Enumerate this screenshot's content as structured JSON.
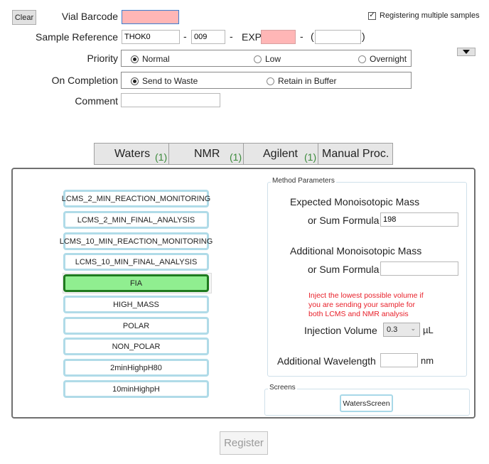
{
  "header": {
    "clear_label": "Clear",
    "vial_barcode_label": "Vial Barcode",
    "vial_barcode_value": "",
    "multi_samples_label": "Registering multiple samples",
    "multi_samples_checked": true,
    "sample_reference_label": "Sample Reference",
    "sample_ref_prefix": "THOK0",
    "sample_ref_sep1": "-",
    "sample_ref_number": "009",
    "sample_ref_sep2": "-",
    "exp_label": "EXP",
    "exp_value": "",
    "sample_ref_sep3": "-",
    "paren_open": "(",
    "paren_value": "",
    "paren_close": ")",
    "priority_label": "Priority",
    "priority_options": [
      "Normal",
      "Low",
      "Overnight"
    ],
    "priority_selected": "Normal",
    "on_completion_label": "On Completion",
    "completion_options": [
      "Send to Waste",
      "Retain in Buffer"
    ],
    "completion_selected": "Send to Waste",
    "comment_label": "Comment",
    "comment_value": "",
    "expand_icon": "triangle-down-icon"
  },
  "tabs": [
    {
      "label": "Waters",
      "count": "(1)"
    },
    {
      "label": "NMR",
      "count": "(1)"
    },
    {
      "label": "Agilent",
      "count": "(1)"
    },
    {
      "label": "Manual Proc.",
      "count": ""
    }
  ],
  "methods": {
    "items": [
      "LCMS_2_MIN_REACTION_MONITORING",
      "LCMS_2_MIN_FINAL_ANALYSIS",
      "LCMS_10_MIN_REACTION_MONITORING",
      "LCMS_10_MIN_FINAL_ANALYSIS",
      "FIA",
      "HIGH_MASS",
      "POLAR",
      "NON_POLAR",
      "2minHighpH80",
      "10minHighpH"
    ],
    "selected": "FIA"
  },
  "method_parameters": {
    "legend": "Method Parameters",
    "expected_mass_label": "Expected Monoisotopic Mass",
    "expected_formula_label": "or Sum Formula",
    "expected_formula_value": "198",
    "additional_mass_label": "Additional Monoisotopic Mass",
    "additional_formula_label": "or Sum Formula",
    "additional_formula_value": "",
    "warning_line1": "Inject the lowest possible volume if",
    "warning_line2": "you are sending your sample for",
    "warning_line3": "both LCMS and NMR analysis",
    "warning_color": "#e8202a",
    "injection_volume_label": "Injection Volume",
    "injection_volume_value": "0.3",
    "injection_volume_unit": "µL",
    "wavelength_label": "Additional Wavelength",
    "wavelength_value": "",
    "wavelength_unit": "nm"
  },
  "screens": {
    "legend": "Screens",
    "button_label": "WatersScreen"
  },
  "footer": {
    "register_label": "Register"
  }
}
